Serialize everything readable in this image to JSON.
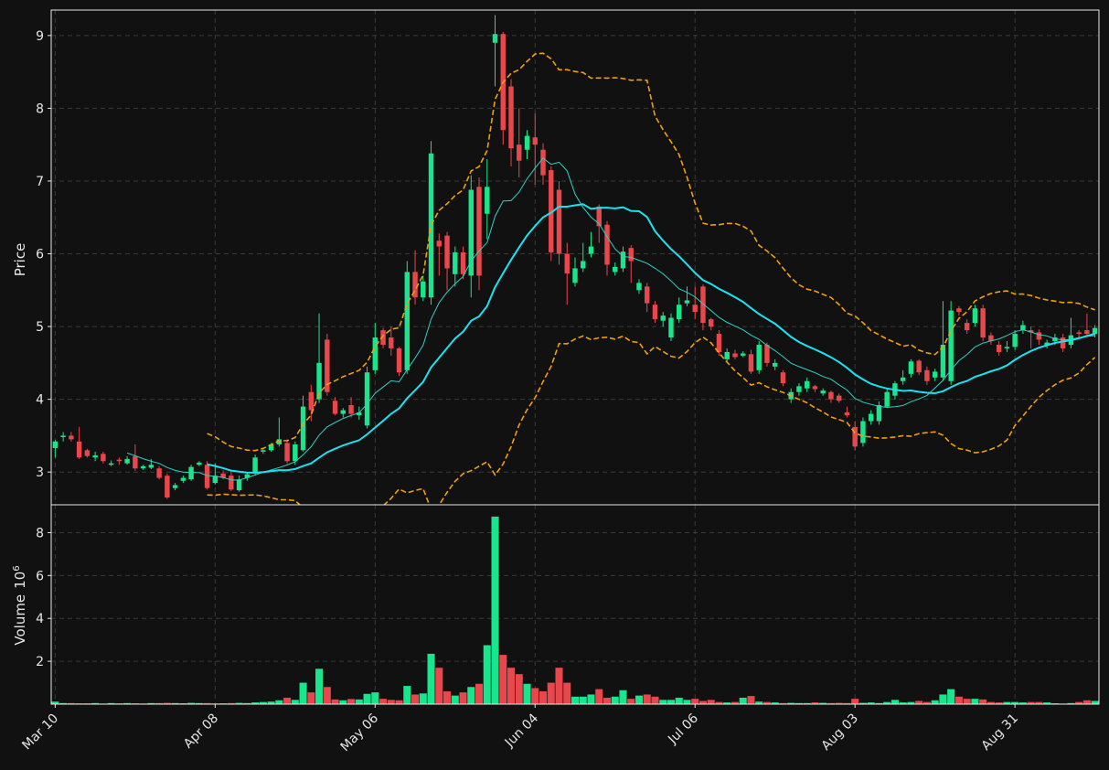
{
  "colors": {
    "background": "#111111",
    "up": "#19e68c",
    "down": "#e8474c",
    "ma_fast": "#2fd1c4",
    "ma_slow": "#19e3f0",
    "band": "#f0a00a",
    "grid": "#3a3a3a",
    "frame": "#e6e6e6"
  },
  "chart_data": {
    "type": "candlestick",
    "ylabel": "Price",
    "volume_ylabel": "Volume",
    "volume_exponent": "10",
    "volume_exponent_power": "6",
    "price_yticks": [
      3,
      4,
      5,
      6,
      7,
      8,
      9
    ],
    "price_ylim": [
      2.55,
      9.35
    ],
    "volume_yticks": [
      2,
      4,
      6,
      8
    ],
    "volume_ylim": [
      0,
      9.3
    ],
    "x_tick_labels": [
      "Mar 10",
      "Apr 08",
      "May 06",
      "Jun 04",
      "Jul 06",
      "Aug 03",
      "Aug 31"
    ],
    "x_tick_index": [
      0,
      20,
      40,
      60,
      80,
      100,
      120
    ],
    "grid": true,
    "series_indicators": [
      "moving average fast",
      "moving average slow",
      "upper band",
      "lower band"
    ],
    "candles": [
      [
        3.33,
        3.42,
        3.2,
        3.44
      ],
      [
        3.48,
        3.5,
        3.42,
        3.55
      ],
      [
        3.5,
        3.45,
        3.42,
        3.55
      ],
      [
        3.42,
        3.2,
        3.18,
        3.62
      ],
      [
        3.3,
        3.22,
        3.2,
        3.32
      ],
      [
        3.2,
        3.23,
        3.15,
        3.28
      ],
      [
        3.25,
        3.15,
        3.12,
        3.28
      ],
      [
        3.1,
        3.12,
        3.08,
        3.16
      ],
      [
        3.17,
        3.15,
        3.1,
        3.2
      ],
      [
        3.12,
        3.18,
        3.1,
        3.22
      ],
      [
        3.22,
        3.05,
        3.02,
        3.38
      ],
      [
        3.05,
        3.08,
        3.03,
        3.1
      ],
      [
        3.06,
        3.1,
        3.04,
        3.18
      ],
      [
        3.05,
        2.92,
        2.9,
        3.08
      ],
      [
        2.95,
        2.65,
        2.63,
        2.98
      ],
      [
        2.78,
        2.82,
        2.75,
        2.85
      ],
      [
        2.88,
        2.92,
        2.85,
        2.95
      ],
      [
        2.9,
        3.07,
        2.88,
        3.1
      ],
      [
        3.1,
        3.13,
        3.08,
        3.15
      ],
      [
        3.1,
        2.78,
        2.76,
        3.15
      ],
      [
        2.85,
        2.95,
        2.83,
        3.12
      ],
      [
        2.98,
        2.92,
        2.9,
        3.02
      ],
      [
        2.95,
        2.76,
        2.74,
        3.02
      ],
      [
        2.75,
        2.9,
        2.73,
        2.95
      ],
      [
        2.92,
        2.97,
        2.88,
        3.0
      ],
      [
        2.98,
        3.2,
        2.95,
        3.24
      ],
      [
        3.28,
        3.3,
        3.25,
        3.32
      ],
      [
        3.3,
        3.38,
        3.28,
        3.4
      ],
      [
        3.38,
        3.45,
        3.35,
        3.75
      ],
      [
        3.4,
        3.15,
        3.12,
        3.45
      ],
      [
        3.15,
        3.38,
        3.1,
        3.42
      ],
      [
        3.3,
        3.9,
        3.28,
        4.05
      ],
      [
        4.1,
        3.85,
        3.7,
        4.2
      ],
      [
        4.0,
        4.5,
        3.95,
        5.18
      ],
      [
        4.82,
        4.1,
        4.05,
        4.9
      ],
      [
        3.98,
        3.8,
        3.78,
        4.03
      ],
      [
        3.8,
        3.85,
        3.75,
        3.88
      ],
      [
        3.92,
        3.8,
        3.75,
        4.03
      ],
      [
        3.78,
        3.82,
        3.72,
        3.9
      ],
      [
        3.64,
        4.37,
        3.6,
        4.45
      ],
      [
        4.4,
        4.85,
        4.35,
        5.05
      ],
      [
        4.95,
        4.75,
        4.7,
        4.98
      ],
      [
        4.85,
        4.7,
        4.6,
        5.0
      ],
      [
        4.7,
        4.37,
        4.32,
        4.72
      ],
      [
        4.4,
        5.75,
        4.35,
        5.9
      ],
      [
        5.75,
        5.4,
        5.3,
        6.05
      ],
      [
        5.4,
        5.62,
        5.35,
        5.7
      ],
      [
        5.4,
        7.38,
        5.3,
        7.55
      ],
      [
        6.18,
        6.1,
        5.7,
        6.28
      ],
      [
        6.25,
        5.8,
        5.5,
        6.3
      ],
      [
        5.72,
        6.02,
        5.55,
        6.1
      ],
      [
        6.02,
        5.72,
        5.65,
        6.1
      ],
      [
        5.7,
        6.88,
        5.4,
        7.08
      ],
      [
        6.92,
        5.7,
        5.5,
        7.05
      ],
      [
        6.55,
        6.92,
        6.2,
        7.3
      ],
      [
        8.9,
        9.02,
        8.3,
        9.28
      ],
      [
        9.02,
        7.7,
        7.5,
        9.05
      ],
      [
        8.3,
        7.45,
        7.2,
        8.4
      ],
      [
        7.5,
        7.28,
        7.05,
        8.0
      ],
      [
        7.43,
        7.62,
        7.3,
        7.7
      ],
      [
        7.6,
        7.5,
        6.95,
        7.93
      ],
      [
        7.43,
        7.08,
        6.95,
        7.52
      ],
      [
        7.15,
        6.02,
        5.9,
        7.2
      ],
      [
        6.88,
        6.0,
        5.85,
        7.0
      ],
      [
        6.0,
        5.73,
        5.3,
        6.15
      ],
      [
        5.6,
        5.8,
        5.55,
        5.95
      ],
      [
        5.8,
        5.9,
        5.75,
        6.15
      ],
      [
        6.0,
        6.1,
        5.95,
        6.3
      ],
      [
        6.65,
        6.38,
        6.15,
        6.68
      ],
      [
        6.4,
        5.85,
        5.7,
        6.45
      ],
      [
        5.75,
        5.82,
        5.7,
        5.88
      ],
      [
        5.8,
        6.03,
        5.75,
        6.1
      ],
      [
        6.08,
        5.9,
        5.6,
        6.12
      ],
      [
        5.5,
        5.6,
        5.45,
        5.65
      ],
      [
        5.55,
        5.32,
        5.2,
        5.6
      ],
      [
        5.3,
        5.1,
        5.05,
        5.35
      ],
      [
        5.08,
        5.15,
        5.0,
        5.2
      ],
      [
        4.85,
        5.12,
        4.8,
        5.18
      ],
      [
        5.1,
        5.3,
        5.05,
        5.4
      ],
      [
        5.32,
        5.36,
        5.28,
        5.55
      ],
      [
        5.3,
        5.2,
        5.1,
        5.55
      ],
      [
        5.55,
        5.05,
        4.95,
        5.58
      ],
      [
        5.1,
        5.0,
        4.95,
        5.12
      ],
      [
        4.9,
        4.65,
        4.6,
        4.95
      ],
      [
        4.55,
        4.65,
        4.5,
        4.7
      ],
      [
        4.63,
        4.58,
        4.55,
        4.68
      ],
      [
        4.6,
        4.63,
        4.58,
        4.66
      ],
      [
        4.62,
        4.38,
        4.35,
        4.68
      ],
      [
        4.4,
        4.75,
        4.35,
        4.8
      ],
      [
        4.75,
        4.5,
        4.45,
        4.78
      ],
      [
        4.45,
        4.5,
        4.4,
        4.55
      ],
      [
        4.37,
        4.22,
        4.18,
        4.4
      ],
      [
        4.0,
        4.1,
        3.95,
        4.15
      ],
      [
        4.1,
        4.18,
        4.05,
        4.22
      ],
      [
        4.15,
        4.25,
        4.1,
        4.3
      ],
      [
        4.18,
        4.14,
        4.1,
        4.2
      ],
      [
        4.08,
        4.12,
        4.05,
        4.15
      ],
      [
        4.1,
        4.0,
        3.95,
        4.12
      ],
      [
        4.05,
        3.98,
        3.95,
        4.08
      ],
      [
        3.82,
        3.78,
        3.75,
        3.9
      ],
      [
        3.62,
        3.35,
        3.3,
        3.7
      ],
      [
        3.4,
        3.7,
        3.35,
        3.75
      ],
      [
        3.7,
        3.8,
        3.65,
        3.85
      ],
      [
        3.7,
        3.92,
        3.65,
        3.97
      ],
      [
        3.9,
        4.1,
        3.88,
        4.15
      ],
      [
        4.05,
        4.22,
        4.0,
        4.25
      ],
      [
        4.25,
        4.3,
        4.2,
        4.4
      ],
      [
        4.35,
        4.52,
        4.3,
        4.55
      ],
      [
        4.53,
        4.37,
        4.33,
        4.55
      ],
      [
        4.4,
        4.25,
        4.2,
        4.45
      ],
      [
        4.3,
        4.38,
        4.25,
        4.42
      ],
      [
        4.3,
        4.75,
        4.25,
        5.35
      ],
      [
        4.25,
        5.22,
        4.2,
        5.35
      ],
      [
        5.25,
        5.2,
        5.15,
        5.28
      ],
      [
        5.05,
        4.95,
        4.9,
        5.1
      ],
      [
        5.05,
        5.25,
        5.0,
        5.3
      ],
      [
        5.25,
        4.85,
        4.8,
        5.3
      ],
      [
        4.88,
        4.8,
        4.75,
        4.92
      ],
      [
        4.75,
        4.65,
        4.6,
        4.8
      ],
      [
        4.7,
        4.72,
        4.65,
        4.8
      ],
      [
        4.72,
        4.9,
        4.68,
        4.95
      ],
      [
        4.95,
        5.02,
        4.9,
        5.08
      ],
      [
        4.95,
        4.92,
        4.7,
        5.0
      ],
      [
        4.92,
        4.82,
        4.75,
        4.96
      ],
      [
        4.75,
        4.78,
        4.7,
        4.82
      ],
      [
        4.8,
        4.85,
        4.75,
        4.9
      ],
      [
        4.85,
        4.7,
        4.65,
        4.9
      ],
      [
        4.75,
        4.88,
        4.7,
        5.12
      ],
      [
        4.92,
        4.9,
        4.85,
        4.95
      ],
      [
        4.95,
        4.9,
        4.85,
        5.18
      ],
      [
        4.9,
        4.98,
        4.85,
        5.02
      ]
    ],
    "volume": [
      0.12,
      0.05,
      0.05,
      0.04,
      0.04,
      0.05,
      0.03,
      0.05,
      0.04,
      0.05,
      0.04,
      0.03,
      0.05,
      0.05,
      0.06,
      0.05,
      0.04,
      0.06,
      0.05,
      0.05,
      0.03,
      0.04,
      0.05,
      0.06,
      0.05,
      0.08,
      0.1,
      0.12,
      0.18,
      0.3,
      0.2,
      1.0,
      0.55,
      1.65,
      0.8,
      0.22,
      0.18,
      0.24,
      0.22,
      0.48,
      0.55,
      0.25,
      0.2,
      0.18,
      0.85,
      0.45,
      0.5,
      2.35,
      1.7,
      0.6,
      0.4,
      0.55,
      0.8,
      0.95,
      2.75,
      8.75,
      2.3,
      1.7,
      1.4,
      0.95,
      0.75,
      0.6,
      1.0,
      1.7,
      1.0,
      0.35,
      0.35,
      0.45,
      0.7,
      0.3,
      0.35,
      0.65,
      0.25,
      0.4,
      0.45,
      0.35,
      0.2,
      0.2,
      0.3,
      0.2,
      0.25,
      0.15,
      0.2,
      0.1,
      0.08,
      0.1,
      0.3,
      0.38,
      0.12,
      0.1,
      0.08,
      0.05,
      0.06,
      0.05,
      0.05,
      0.08,
      0.06,
      0.05,
      0.06,
      0.05,
      0.25,
      0.06,
      0.08,
      0.05,
      0.1,
      0.2,
      0.08,
      0.1,
      0.15,
      0.1,
      0.18,
      0.45,
      0.7,
      0.35,
      0.25,
      0.25,
      0.22,
      0.1,
      0.08,
      0.1,
      0.1,
      0.08,
      0.1,
      0.1,
      0.08,
      0.04,
      0.03,
      0.05,
      0.1,
      0.18,
      0.15
    ]
  }
}
